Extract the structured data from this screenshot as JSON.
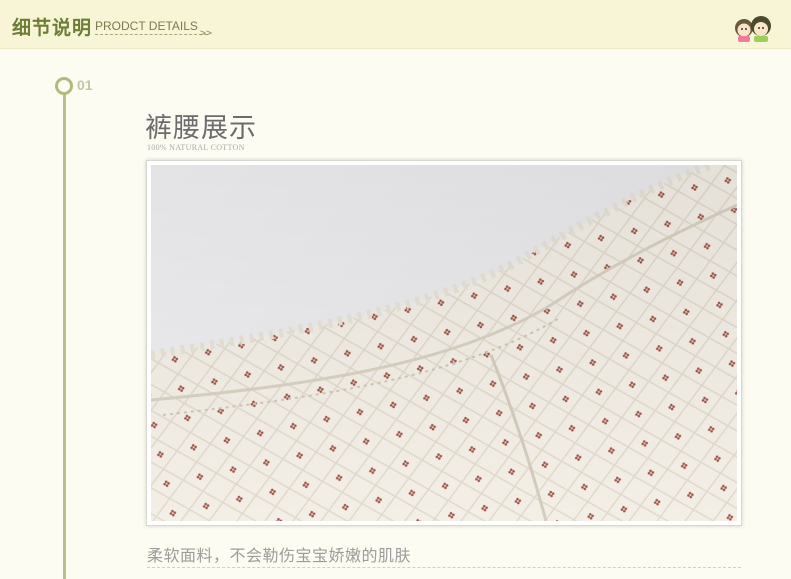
{
  "header": {
    "title_cn": "细节说明",
    "title_en": "PRODCT DETAILS",
    "arrows": ">>"
  },
  "section": {
    "number": "01",
    "title_cn": "裤腰展示",
    "title_en": "100% NATURAL COTTON"
  },
  "photo": {
    "icon": "quilted-waistband-photo"
  },
  "caption": "柔软面料，不会勒伤宝宝娇嫩的肌肤",
  "colors": {
    "header_bg": "#f7f5d6",
    "accent_green": "#6d7d36",
    "timeline": "#b9c08c",
    "fabric_dot": "#a0554a"
  }
}
